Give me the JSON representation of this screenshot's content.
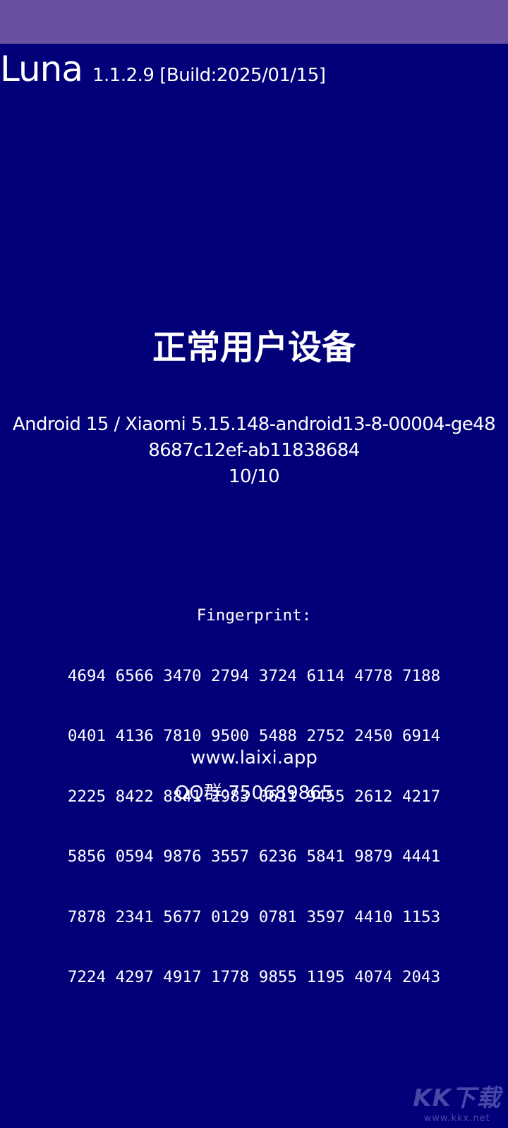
{
  "app": {
    "name": "Luna",
    "version": "1.1.2.9 [Build:2025/01/15]"
  },
  "status": {
    "title": "正常用户设备"
  },
  "device": {
    "line1": "Android 15 / Xiaomi 5.15.148-android13-8-00004-ge48",
    "line2": "8687c12ef-ab11838684",
    "score": "10/10"
  },
  "fingerprint": {
    "label": "Fingerprint:",
    "rows": [
      "4694 6566 3470 2794 3724 6114 4778 7188",
      "0401 4136 7810 9500 5488 2752 2450 6914",
      "2225 8422 8841 2983 0611 9455 2612 4217",
      "5856 0594 9876 3557 6236 5841 9879 4441",
      "7878 2341 5677 0129 0781 3597 4410 1153",
      "7224 4297 4917 1778 9855 1195 4074 2043"
    ]
  },
  "links": {
    "website": "www.laixi.app",
    "qq": "QQ群:750689865"
  },
  "watermark": {
    "brand": "KK下载",
    "url": "www.kkx.net"
  },
  "colors": {
    "background": "#010079",
    "status_bar": "#6a4fa2",
    "text": "#ffffff"
  }
}
